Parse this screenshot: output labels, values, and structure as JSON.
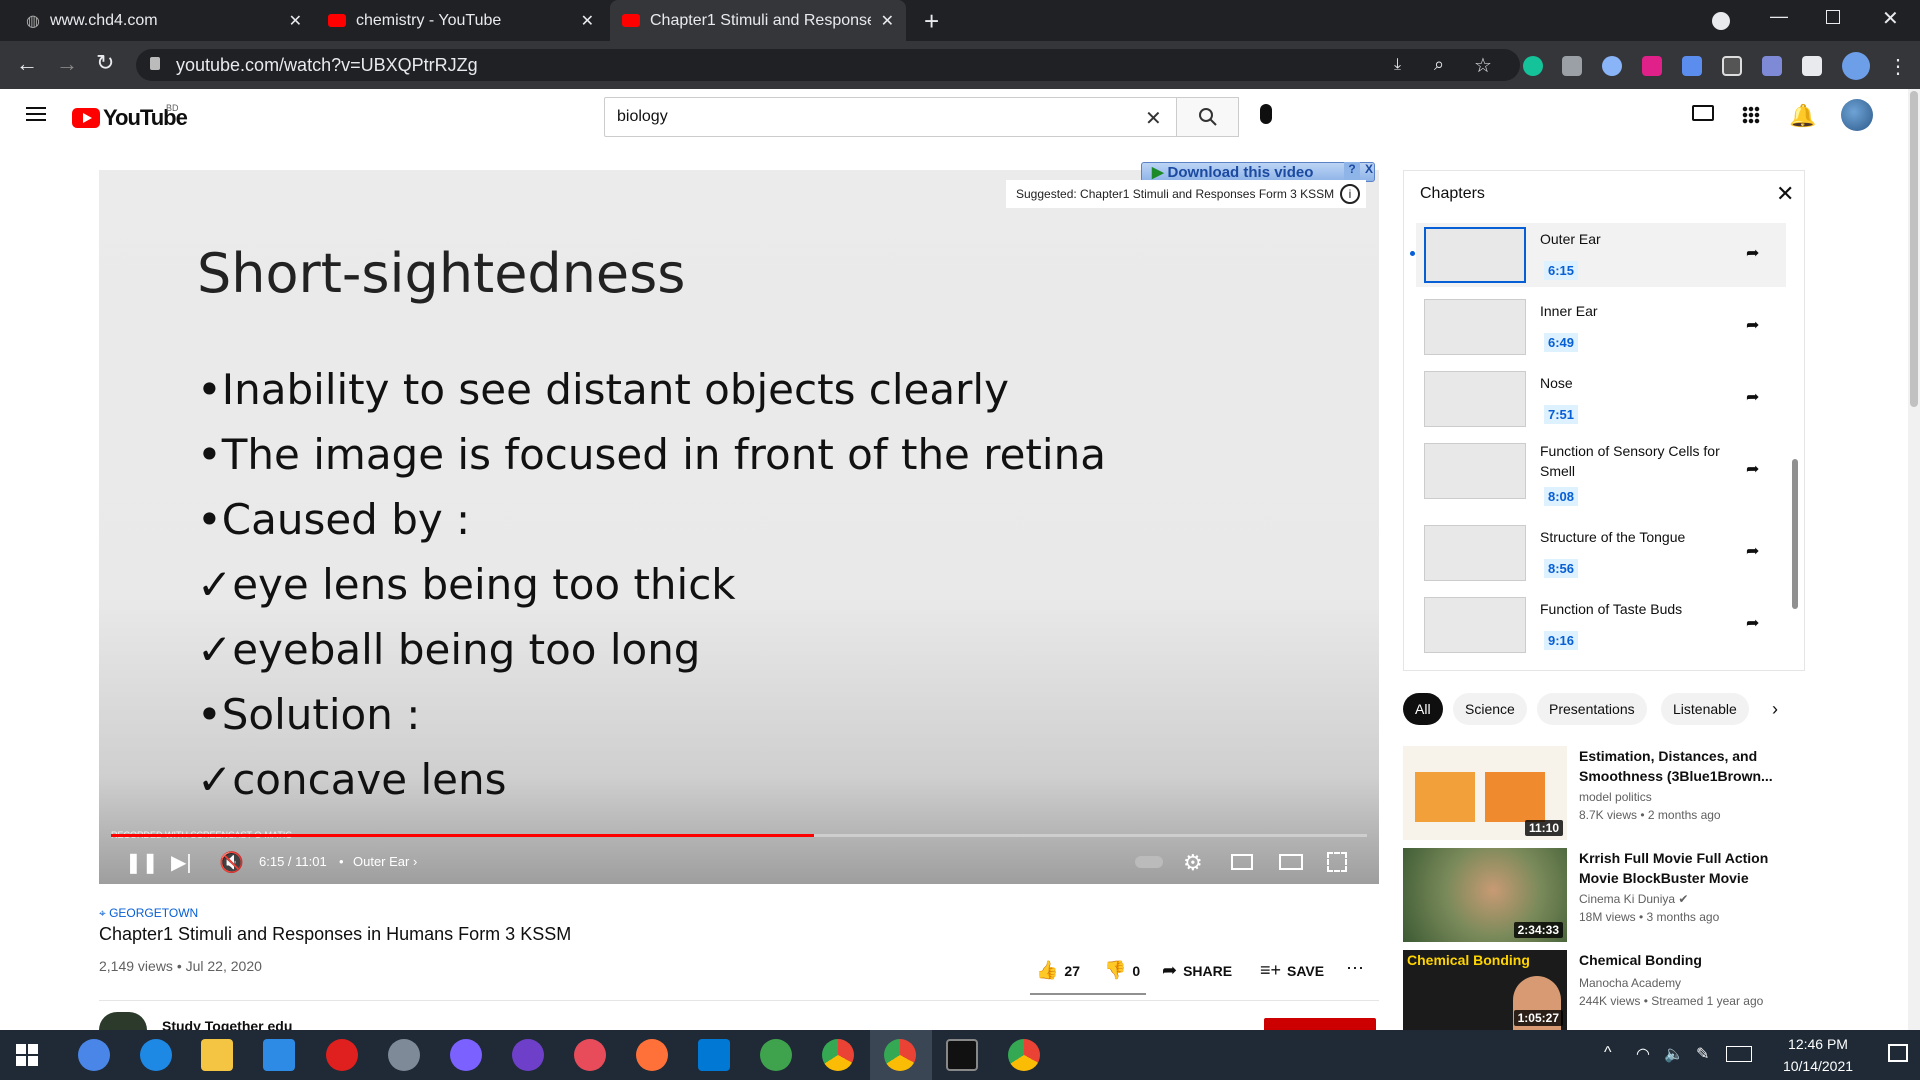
{
  "browser": {
    "tabs": [
      {
        "label": "www.chd4.com",
        "active": false
      },
      {
        "label": "chemistry - YouTube",
        "active": false
      },
      {
        "label": "Chapter1 Stimuli and Responses",
        "active": true
      }
    ],
    "url": "youtube.com/watch?v=UBXQPtrRJZg",
    "new_tab_symbol": "+"
  },
  "youtube": {
    "logo_text": "YouTube",
    "region": "BD",
    "search_value": "biology"
  },
  "extension": {
    "download_label": "Download this video",
    "suggested": "Suggested: Chapter1 Stimuli and Responses Form 3 KSSM",
    "help": "?",
    "close": "X"
  },
  "slide": {
    "title": "Short-sightedness",
    "lines": [
      "•Inability to see distant objects clearly",
      "•The image is focused in front of the retina",
      "•Caused by :",
      "✓eye lens being too thick",
      "✓eyeball being too long",
      "•Solution :",
      "✓concave lens"
    ],
    "watermark": "RECORDED WITH SCREENCAST-O-MATIC"
  },
  "player": {
    "time": "6:15 / 11:01",
    "chapter": "Outer Ear",
    "progress": 0.56
  },
  "chapters": {
    "heading": "Chapters",
    "items": [
      {
        "title": "Outer Ear",
        "time": "6:15",
        "current": true
      },
      {
        "title": "Inner Ear",
        "time": "6:49",
        "current": false
      },
      {
        "title": "Nose",
        "time": "7:51",
        "current": false
      },
      {
        "title": "Function of Sensory Cells for Smell",
        "time": "8:08",
        "current": false
      },
      {
        "title": "Structure of the Tongue",
        "time": "8:56",
        "current": false
      },
      {
        "title": "Function of Taste Buds",
        "time": "9:16",
        "current": false
      }
    ]
  },
  "chips": [
    "All",
    "Science",
    "Presentations",
    "Listenable"
  ],
  "recommendations": [
    {
      "title": "Estimation, Distances, and Smoothness (3Blue1Brown...",
      "channel": "model politics",
      "meta": "8.7K views • 2 months ago",
      "duration": "11:10",
      "thumb_color": "#f7f3ea"
    },
    {
      "title": "Krrish Full Movie Full Action Movie BlockBuster Movie",
      "channel": "Cinema Ki Duniya",
      "meta": "18M views • 3 months ago",
      "duration": "2:34:33",
      "thumb_color": "#5e7a4c"
    },
    {
      "title": "Chemical Bonding",
      "channel": "Manocha Academy",
      "meta": "244K views • Streamed 1 year ago",
      "duration": "1:05:27",
      "thumb_color": "#1b1b1b",
      "thumb_text": "Chemical Bonding"
    }
  ],
  "video": {
    "location": "GEORGETOWN",
    "title": "Chapter1 Stimuli and Responses in Humans Form 3 KSSM",
    "stats": "2,149 views • Jul 22, 2020",
    "likes": "27",
    "dislikes": "0",
    "share_label": "SHARE",
    "save_label": "SAVE",
    "channel": "Study Together edu"
  },
  "taskbar": {
    "time": "12:46 PM",
    "date": "10/14/2021"
  }
}
